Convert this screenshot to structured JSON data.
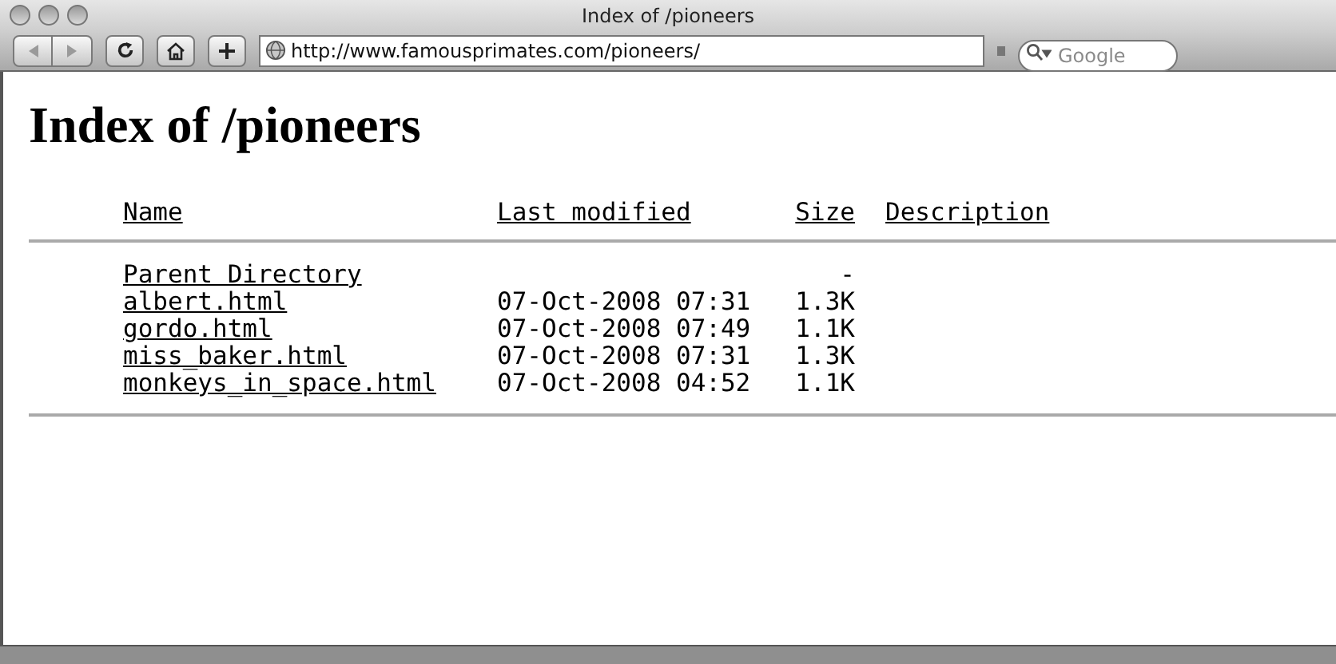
{
  "window": {
    "title": "Index of /pioneers"
  },
  "toolbar": {
    "url": "http://www.famousprimates.com/pioneers/",
    "search": {
      "placeholder": "Google"
    }
  },
  "page": {
    "heading": "Index of /pioneers",
    "columns": [
      "Name",
      "Last modified",
      "Size",
      "Description"
    ],
    "rows": [
      {
        "name": "Parent Directory",
        "modified": "",
        "size": "-"
      },
      {
        "name": "albert.html",
        "modified": "07-Oct-2008 07:31",
        "size": "1.3K"
      },
      {
        "name": "gordo.html",
        "modified": "07-Oct-2008 07:49",
        "size": "1.1K"
      },
      {
        "name": "miss_baker.html",
        "modified": "07-Oct-2008 07:31",
        "size": "1.3K"
      },
      {
        "name": "monkeys_in_space.html",
        "modified": "07-Oct-2008 04:52",
        "size": "1.1K"
      }
    ]
  }
}
